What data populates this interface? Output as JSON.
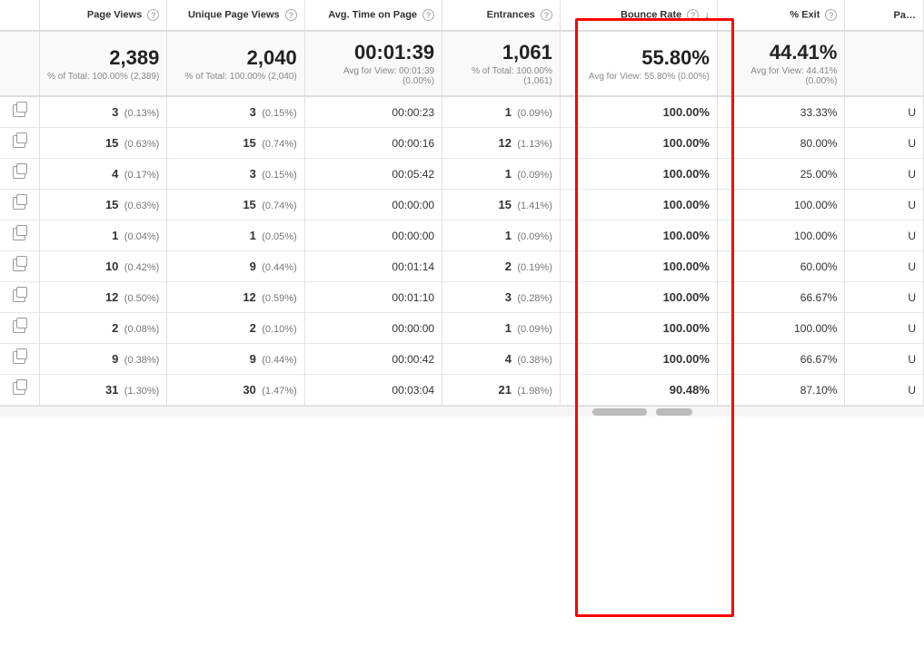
{
  "columns": [
    {
      "id": "icon",
      "label": "",
      "help": false,
      "sort": false
    },
    {
      "id": "page_views",
      "label": "Page Views",
      "help": true,
      "sort": false
    },
    {
      "id": "unique_page_views",
      "label": "Unique Page Views",
      "help": true,
      "sort": false
    },
    {
      "id": "avg_time",
      "label": "Avg. Time on Page",
      "help": true,
      "sort": false
    },
    {
      "id": "entrances",
      "label": "Entrances",
      "help": true,
      "sort": false
    },
    {
      "id": "bounce_rate",
      "label": "Bounce Rate",
      "help": true,
      "sort": true
    },
    {
      "id": "pct_exit",
      "label": "% Exit",
      "help": true,
      "sort": false
    },
    {
      "id": "page_value",
      "label": "Pa…",
      "help": false,
      "sort": false
    }
  ],
  "summary": {
    "page_views": {
      "main": "2,389",
      "sub": "% of Total: 100.00% (2,389)"
    },
    "unique_page_views": {
      "main": "2,040",
      "sub": "% of Total: 100.00% (2,040)"
    },
    "avg_time": {
      "main": "00:01:39",
      "sub": "Avg for View: 00:01:39 (0.00%)"
    },
    "entrances": {
      "main": "1,061",
      "sub": "% of Total: 100.00% (1,061)"
    },
    "bounce_rate": {
      "main": "55.80%",
      "sub": "Avg for View: 55.80% (0.00%)"
    },
    "pct_exit": {
      "main": "44.41%",
      "sub": "Avg for View: 44.41% (0.00%)"
    },
    "page_value": {
      "main": "",
      "sub": ""
    }
  },
  "rows": [
    {
      "pv": "3",
      "pv_pct": "(0.13%)",
      "upv": "3",
      "upv_pct": "(0.15%)",
      "avg": "00:00:23",
      "ent": "1",
      "ent_pct": "(0.09%)",
      "br": "100.00%",
      "exit": "33.33%",
      "pv2": "U"
    },
    {
      "pv": "15",
      "pv_pct": "(0.63%)",
      "upv": "15",
      "upv_pct": "(0.74%)",
      "avg": "00:00:16",
      "ent": "12",
      "ent_pct": "(1.13%)",
      "br": "100.00%",
      "exit": "80.00%",
      "pv2": "U"
    },
    {
      "pv": "4",
      "pv_pct": "(0.17%)",
      "upv": "3",
      "upv_pct": "(0.15%)",
      "avg": "00:05:42",
      "ent": "1",
      "ent_pct": "(0.09%)",
      "br": "100.00%",
      "exit": "25.00%",
      "pv2": "U"
    },
    {
      "pv": "15",
      "pv_pct": "(0.63%)",
      "upv": "15",
      "upv_pct": "(0.74%)",
      "avg": "00:00:00",
      "ent": "15",
      "ent_pct": "(1.41%)",
      "br": "100.00%",
      "exit": "100.00%",
      "pv2": "U"
    },
    {
      "pv": "1",
      "pv_pct": "(0.04%)",
      "upv": "1",
      "upv_pct": "(0.05%)",
      "avg": "00:00:00",
      "ent": "1",
      "ent_pct": "(0.09%)",
      "br": "100.00%",
      "exit": "100.00%",
      "pv2": "U"
    },
    {
      "pv": "10",
      "pv_pct": "(0.42%)",
      "upv": "9",
      "upv_pct": "(0.44%)",
      "avg": "00:01:14",
      "ent": "2",
      "ent_pct": "(0.19%)",
      "br": "100.00%",
      "exit": "60.00%",
      "pv2": "U"
    },
    {
      "pv": "12",
      "pv_pct": "(0.50%)",
      "upv": "12",
      "upv_pct": "(0.59%)",
      "avg": "00:01:10",
      "ent": "3",
      "ent_pct": "(0.28%)",
      "br": "100.00%",
      "exit": "66.67%",
      "pv2": "U"
    },
    {
      "pv": "2",
      "pv_pct": "(0.08%)",
      "upv": "2",
      "upv_pct": "(0.10%)",
      "avg": "00:00:00",
      "ent": "1",
      "ent_pct": "(0.09%)",
      "br": "100.00%",
      "exit": "100.00%",
      "pv2": "U"
    },
    {
      "pv": "9",
      "pv_pct": "(0.38%)",
      "upv": "9",
      "upv_pct": "(0.44%)",
      "avg": "00:00:42",
      "ent": "4",
      "ent_pct": "(0.38%)",
      "br": "100.00%",
      "exit": "66.67%",
      "pv2": "U"
    },
    {
      "pv": "31",
      "pv_pct": "(1.30%)",
      "upv": "30",
      "upv_pct": "(1.47%)",
      "avg": "00:03:04",
      "ent": "21",
      "ent_pct": "(1.98%)",
      "br": "90.48%",
      "exit": "87.10%",
      "pv2": "U"
    }
  ],
  "labels": {
    "page_views": "Page Views",
    "unique_page_views": "Unique Page Views",
    "avg_time": "Avg. Time on Page",
    "entrances": "Entrances",
    "bounce_rate": "Bounce Rate",
    "pct_exit": "% Exit",
    "page_value": "Pa…"
  }
}
